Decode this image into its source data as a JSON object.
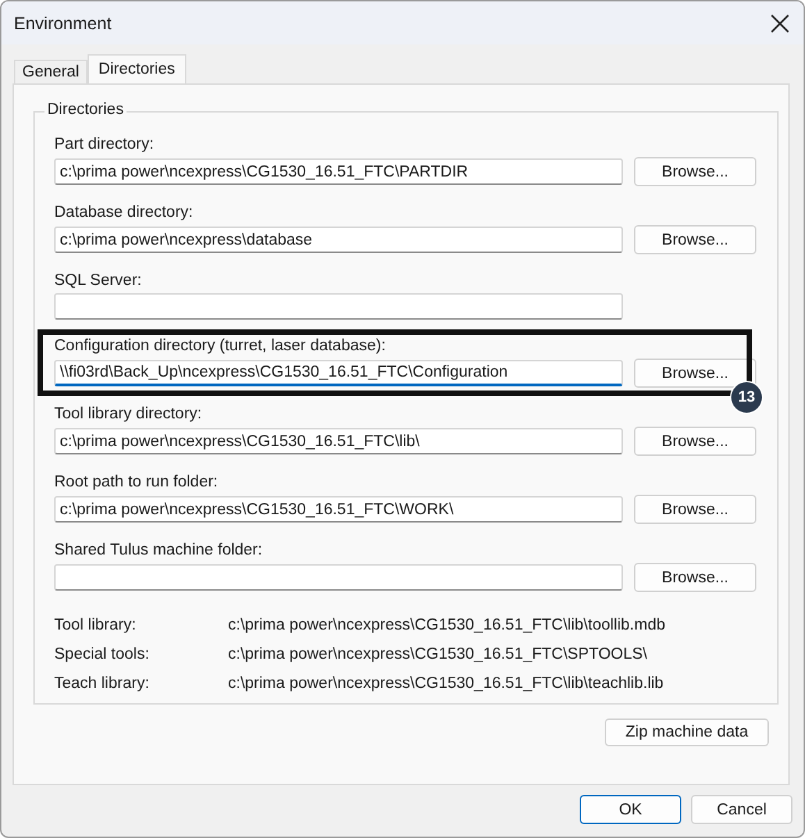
{
  "window": {
    "title": "Environment"
  },
  "tabs": [
    {
      "label": "General",
      "selected": false
    },
    {
      "label": "Directories",
      "selected": true
    }
  ],
  "group": {
    "title": "Directories"
  },
  "fields": [
    {
      "label": "Part directory:",
      "value": "c:\\prima power\\ncexpress\\CG1530_16.51_FTC\\PARTDIR",
      "button": "Browse...",
      "focused": false
    },
    {
      "label": "Database directory:",
      "value": "c:\\prima power\\ncexpress\\database",
      "button": "Browse...",
      "focused": false
    },
    {
      "label": "SQL Server:",
      "focused": false
    },
    {
      "label": "Configuration directory (turret, laser database):",
      "value": "\\\\fi03rd\\Back_Up\\ncexpress\\CG1530_16.51_FTC\\Configuration",
      "button": "Browse...",
      "focused": true,
      "callout": "13"
    },
    {
      "label": "Tool library directory:",
      "value": "c:\\prima power\\ncexpress\\CG1530_16.51_FTC\\lib\\",
      "button": "Browse...",
      "focused": false
    },
    {
      "label": "Root path to run folder:",
      "value": "c:\\prima power\\ncexpress\\CG1530_16.51_FTC\\WORK\\",
      "button": "Browse...",
      "focused": false
    },
    {
      "label": "Shared Tulus machine folder:",
      "button": "Browse...",
      "focused": false
    }
  ],
  "info": [
    {
      "label": "Tool library:",
      "value": "c:\\prima power\\ncexpress\\CG1530_16.51_FTC\\lib\\toollib.mdb"
    },
    {
      "label": "Special tools:",
      "value": "c:\\prima power\\ncexpress\\CG1530_16.51_FTC\\SPTOOLS\\"
    },
    {
      "label": "Teach library:",
      "value": "c:\\prima power\\ncexpress\\CG1530_16.51_FTC\\lib\\teachlib.lib"
    }
  ],
  "zip_button": "Zip machine data",
  "buttons": [
    {
      "label": "OK",
      "default": true
    },
    {
      "label": "Cancel",
      "default": false
    }
  ]
}
